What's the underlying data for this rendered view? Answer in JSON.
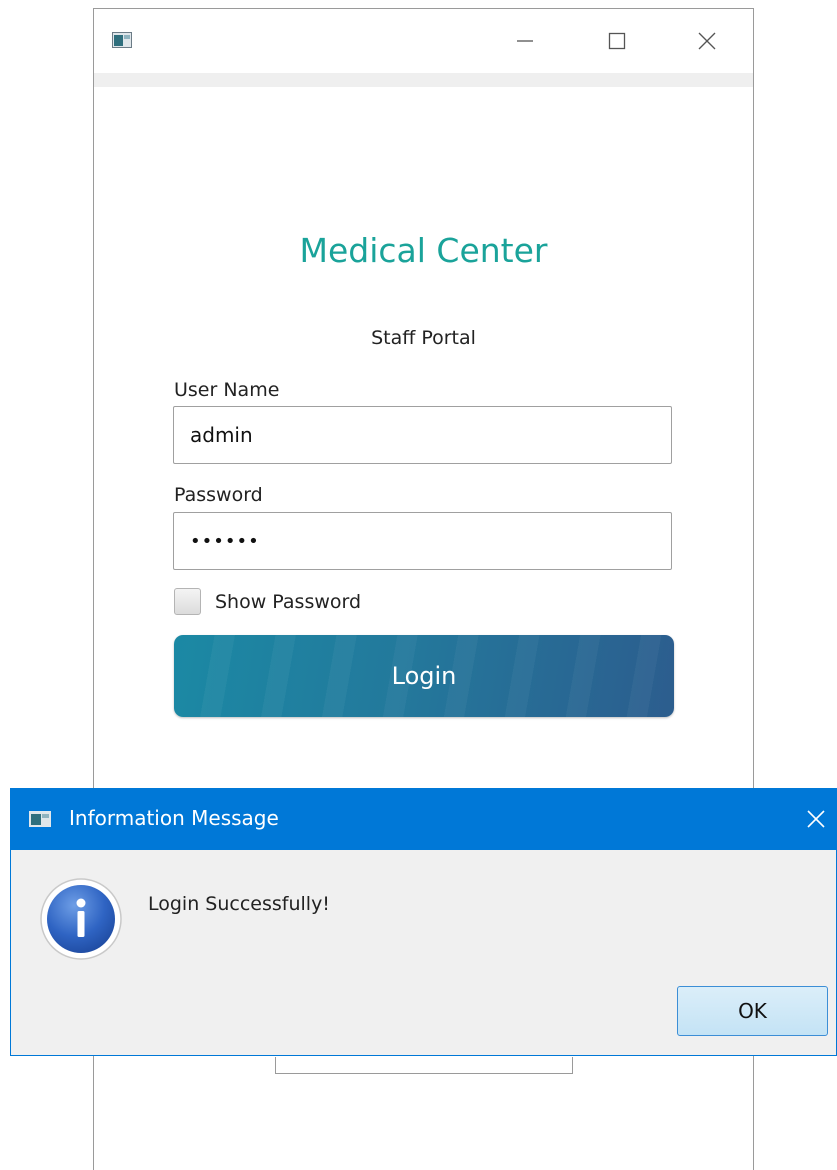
{
  "main_window": {
    "title": "",
    "app_title": "Medical Center",
    "subtitle": "Staff Portal",
    "username_label": "User Name",
    "username_value": "admin",
    "password_label": "Password",
    "password_value": "••••••",
    "show_password_label": "Show Password",
    "show_password_checked": false,
    "login_label": "Login"
  },
  "dialog": {
    "title": "Information Message",
    "message": "Login Successfully!",
    "ok_label": "OK"
  },
  "colors": {
    "title_teal": "#1aa39a",
    "dialog_blue": "#0078d7",
    "login_start": "#1b89a4",
    "login_end": "#2c5d8e"
  },
  "icons": {
    "app": "app-window-icon",
    "minimize": "minimize-icon",
    "maximize": "maximize-icon",
    "close": "close-icon",
    "info": "info-icon"
  }
}
